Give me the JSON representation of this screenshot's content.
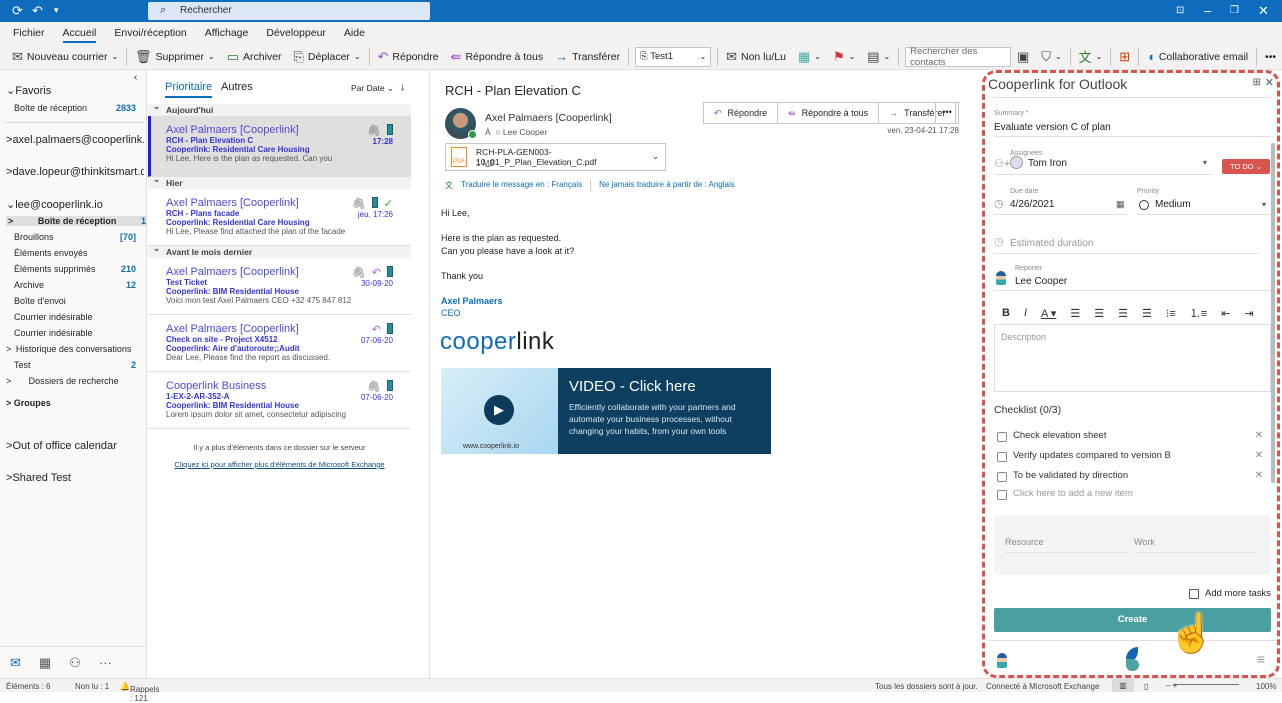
{
  "titlebar": {
    "search_placeholder": "Rechercher"
  },
  "menu": [
    "Fichier",
    "Accueil",
    "Envoi/réception",
    "Affichage",
    "Développeur",
    "Aide"
  ],
  "ribbon": {
    "new_mail": "Nouveau courrier",
    "delete": "Supprimer",
    "archive": "Archiver",
    "move": "Déplacer",
    "reply": "Répondre",
    "reply_all": "Répondre à tous",
    "forward": "Transférer",
    "quick_step": "Test1",
    "unread": "Non lu/Lu",
    "contact_search_placeholder": "Rechercher des contacts",
    "collab_email": "Collaborative email"
  },
  "folders": {
    "favorites": "Favoris",
    "fav_inbox": "Boîte de réception",
    "fav_inbox_count": "2833",
    "accounts": [
      "axel.palmaers@cooperlink.io",
      "dave.lopeur@thinkitsmart.com",
      "lee@cooperlink.io"
    ],
    "items": [
      {
        "label": "Boîte de réception",
        "count": "1"
      },
      {
        "label": "Brouillons",
        "count": "[70]"
      },
      {
        "label": "Éléments envoyés",
        "count": ""
      },
      {
        "label": "Éléments supprimés",
        "count": "210"
      },
      {
        "label": "Archive",
        "count": "12"
      },
      {
        "label": "Boîte d'envoi",
        "count": ""
      },
      {
        "label": "Courrier indésirable",
        "count": ""
      },
      {
        "label": "Courrier indésirable",
        "count": ""
      },
      {
        "label": "Historique des conversations",
        "count": ""
      },
      {
        "label": "Test",
        "count": "2"
      },
      {
        "label": "Dossiers de recherche",
        "count": ""
      }
    ],
    "groups": "Groupes",
    "out_of_office": "Out of office calendar",
    "shared": "Shared Test"
  },
  "list": {
    "tab_focused": "Prioritaire",
    "tab_other": "Autres",
    "sort": "Par Date",
    "groups": [
      "Aujourd'hui",
      "Hier",
      "Avant le mois dernier"
    ],
    "messages": [
      {
        "from": "Axel Palmaers [Cooperlink]",
        "subject": "RCH - Plan Elevation C",
        "project": "Cooperlink: Residential Care Housing",
        "preview": "Hi Lee,  Here is the plan as requested.  Can you",
        "date": "17:28"
      },
      {
        "from": "Axel Palmaers [Cooperlink]",
        "subject": "RCH - Plans facade",
        "project": "Cooperlink: Residential Care Housing",
        "preview": "Hi Lee,  Please find attached the plan of the facade",
        "date": "jeu. 17:26"
      },
      {
        "from": "Axel Palmaers [Cooperlink]",
        "subject": "Test Ticket",
        "project": "Cooperlink: BIM Residential House",
        "preview": "Voici mon test  Axel Palmaers  CEO  +32 475 847 812",
        "date": "30-09-20"
      },
      {
        "from": "Axel Palmaers [Cooperlink]",
        "subject": "Check on site - Project X4512",
        "project": "Cooperlink: Aire d'autoroute;;Audit",
        "preview": "Dear Lee,  Please find the report as discussed.",
        "date": "07-06-20"
      },
      {
        "from": "Cooperlink Business",
        "subject": "1-EX-2-AR-352-A",
        "project": "Cooperlink: BIM Residential House",
        "preview": "Lorem ipsum dolor sit amet, consectetur adipiscing",
        "date": "07-06-20"
      }
    ],
    "more_server": "Il y a plus d'éléments dans ce dossier sur le serveur",
    "more_link": "Cliquez ici pour afficher plus d'éléments de Microsoft Exchange"
  },
  "reading": {
    "subject": "RCH - Plan Elevation C",
    "sender": "Axel Palmaers [Cooperlink]",
    "to_label": "À",
    "to": "Lee Cooper",
    "reply": "Répondre",
    "reply_all": "Répondre à tous",
    "forward": "Transférer",
    "date": "ven. 23-04-21 17:28",
    "attachment_name": "RCH-PLA-GEN003-10_01_P_Plan_Elevation_C.pdf",
    "attachment_size": "1 MB",
    "translate": "Traduire le message en : Français",
    "never_translate": "Ne jamais traduire à partir de : Anglais",
    "body": [
      "Hi Lee,",
      "Here is the plan as requested.",
      "Can you please have a look at it?",
      "Thank you"
    ],
    "sig_name": "Axel Palmaers",
    "sig_title": "CEO",
    "logo_a": "cooper",
    "logo_b": "link",
    "banner_url": "www.cooperlink.io",
    "banner_title": "VIDEO - Click here",
    "banner_text": "Efficiently collaborate with your partners and automate your business processes, without changing your habits, from your own tools"
  },
  "panel": {
    "title": "Cooperlink for Outlook",
    "summary_label": "Summary *",
    "summary": "Evaluate version C of plan",
    "assignees_label": "Assignees",
    "assignee": "Tom Iron",
    "status": "TO DO",
    "due_label": "Due date",
    "due": "4/26/2021",
    "priority_label": "Priority",
    "priority": "Medium",
    "duration_placeholder": "Estimated duration",
    "reporter_label": "Reporter",
    "reporter": "Lee Cooper",
    "description_placeholder": "Description",
    "checklist_title": "Checklist (0/3)",
    "checklist": [
      "Check elevation sheet",
      "Verify updates compared to version B",
      "To be validated by direction"
    ],
    "add_item": "Click here to add a new item",
    "resource_placeholder": "Resource",
    "work_placeholder": "Work",
    "add_more": "Add more tasks",
    "create": "Create",
    "accent": "#4a9fa0",
    "status_color": "#d9534f"
  },
  "status": {
    "items": "Éléments : 6",
    "unread": "Non lu : 1",
    "reminders": "Rappels : 121",
    "uptodate": "Tous les dossiers sont à jour.",
    "connected": "Connecté à Microsoft Exchange",
    "zoom": "100%"
  }
}
